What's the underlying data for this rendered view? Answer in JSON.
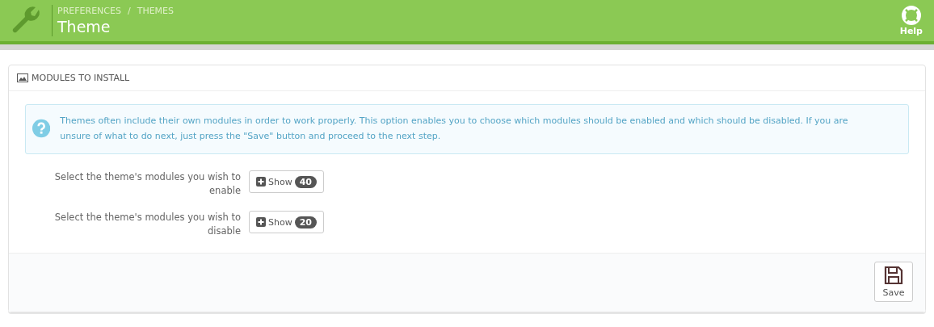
{
  "header": {
    "breadcrumb": [
      {
        "label": "PREFERENCES"
      },
      {
        "label": "THEMES"
      }
    ],
    "separator": "/",
    "title": "Theme",
    "help": "Help"
  },
  "panel": {
    "heading": "MODULES TO INSTALL",
    "alert": "Themes often include their own modules in order to work properly. This option enables you to choose which modules should be enabled and which should be disabled. If you are unsure of what to do next, just press the \"Save\" button and proceed to the next step.",
    "rows": [
      {
        "label": "Select the theme's modules you wish to enable",
        "button": "Show",
        "count": "40"
      },
      {
        "label": "Select the theme's modules you wish to disable",
        "button": "Show",
        "count": "20"
      }
    ],
    "save": "Save"
  }
}
